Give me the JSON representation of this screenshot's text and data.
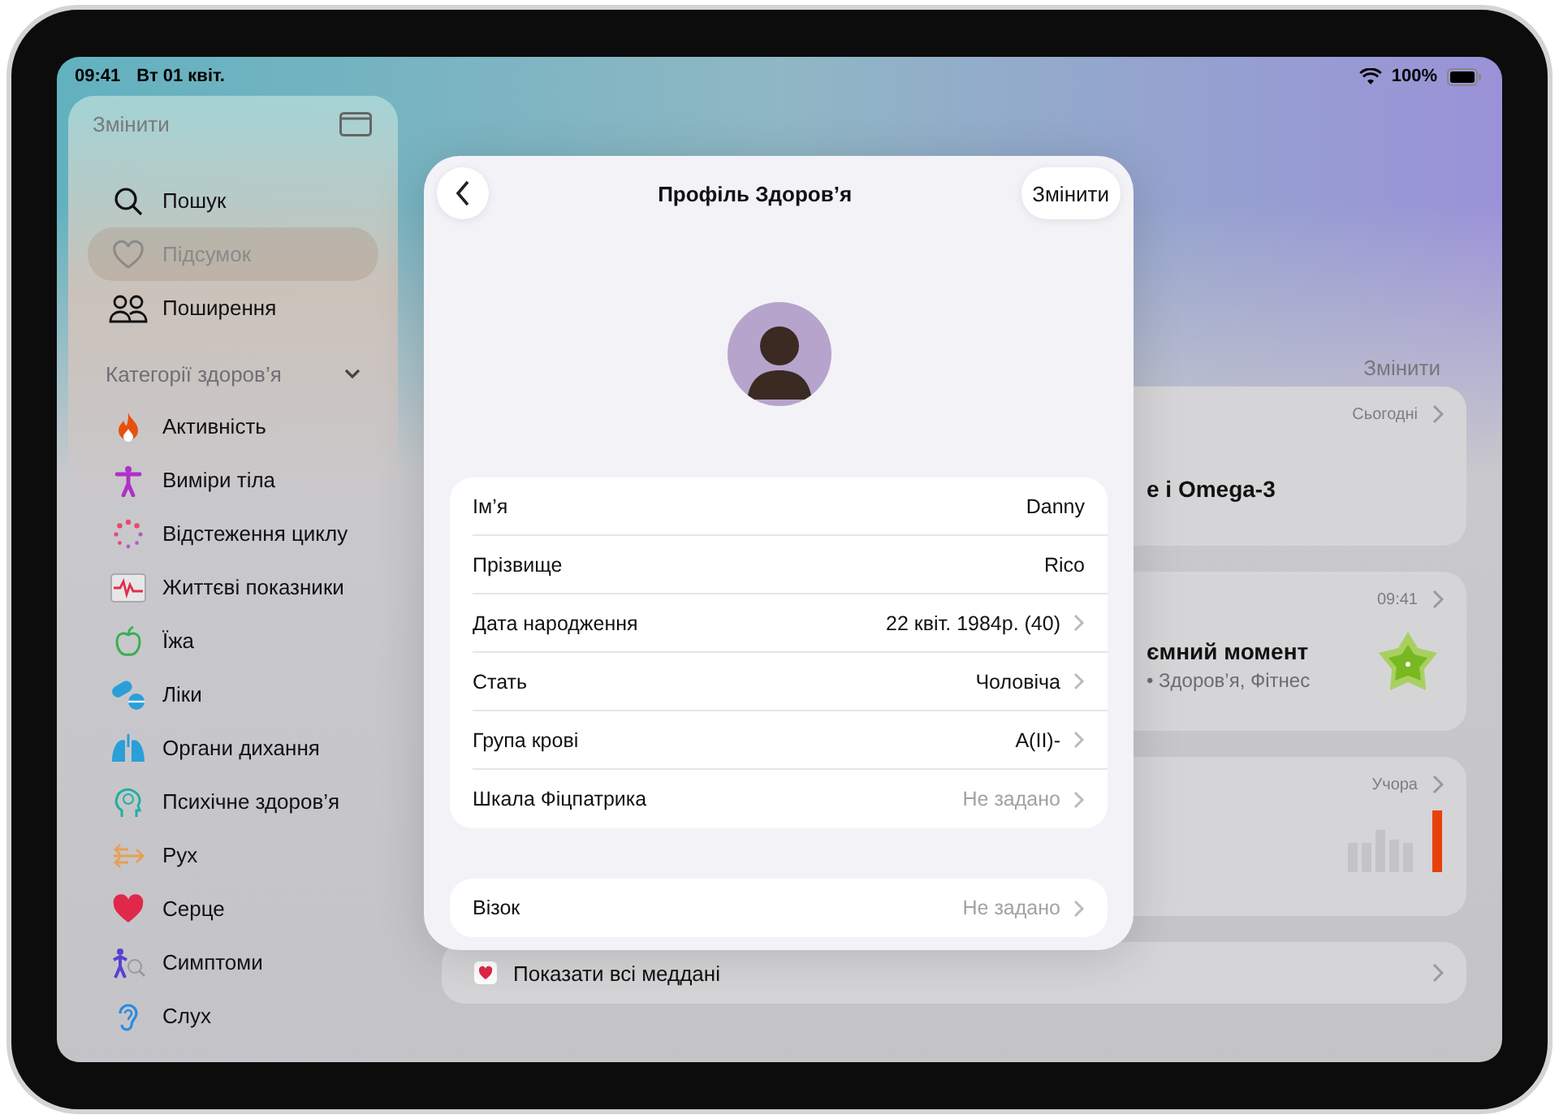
{
  "status_bar": {
    "time": "09:41",
    "date": "Вт 01 квіт.",
    "battery": "100%"
  },
  "sidebar": {
    "edit_label": "Змінити",
    "items": [
      {
        "label": "Пошук",
        "selected": false
      },
      {
        "label": "Підсумок",
        "selected": true
      },
      {
        "label": "Поширення",
        "selected": false
      }
    ],
    "section": {
      "title": "Категорії здоров’я",
      "expanded": true,
      "items": [
        {
          "label": "Активність"
        },
        {
          "label": "Виміри тіла"
        },
        {
          "label": "Відстеження циклу"
        },
        {
          "label": "Життєві показники"
        },
        {
          "label": "Їжа"
        },
        {
          "label": "Ліки"
        },
        {
          "label": "Органи дихання"
        },
        {
          "label": "Психічне здоров’я"
        },
        {
          "label": "Рух"
        },
        {
          "label": "Серце"
        },
        {
          "label": "Симптоми"
        },
        {
          "label": "Слух"
        }
      ]
    }
  },
  "main": {
    "edit_label": "Змінити",
    "cards": [
      {
        "kind": "text",
        "meta": "Сьогодні",
        "title": "е і Omega-3"
      },
      {
        "kind": "moment",
        "meta": "09:41",
        "title": "ємний момент",
        "subtitle": "• Здоров’я, Фітнес"
      },
      {
        "kind": "chart",
        "meta": "Учора"
      },
      {
        "kind": "link",
        "title": "Показати всі меддані"
      }
    ]
  },
  "sheet": {
    "title": "Профіль Здоров’я",
    "edit_button": "Змінити",
    "groups": [
      {
        "rows": [
          {
            "label": "Ім’я",
            "value": "Danny",
            "muted": false,
            "disclosure": false
          },
          {
            "label": "Прізвище",
            "value": "Rico",
            "muted": false,
            "disclosure": false
          },
          {
            "label": "Дата народження",
            "value": "22 квіт. 1984р. (40)",
            "muted": false,
            "disclosure": true
          },
          {
            "label": "Стать",
            "value": "Чоловіча",
            "muted": false,
            "disclosure": true
          },
          {
            "label": "Група крові",
            "value": "A(II)-",
            "muted": false,
            "disclosure": true
          },
          {
            "label": "Шкала Фіцпатрика",
            "value": "Не задано",
            "muted": true,
            "disclosure": true
          }
        ]
      },
      {
        "rows": [
          {
            "label": "Візок",
            "value": "Не задано",
            "muted": true,
            "disclosure": true
          }
        ]
      }
    ]
  }
}
